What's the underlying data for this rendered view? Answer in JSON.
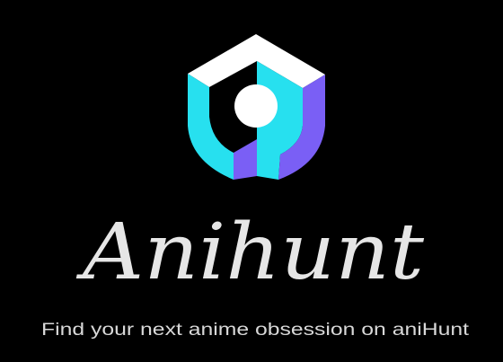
{
  "brand": {
    "name": "Anihunt",
    "tagline": "Find your next anime obsession on aniHunt",
    "colors": {
      "background": "#000000",
      "cyan": "#27e0ef",
      "purple": "#7a5ff5",
      "white": "#ffffff",
      "text": "#e6e6e6"
    },
    "logo_icon": "shield-cube-logo-icon"
  }
}
